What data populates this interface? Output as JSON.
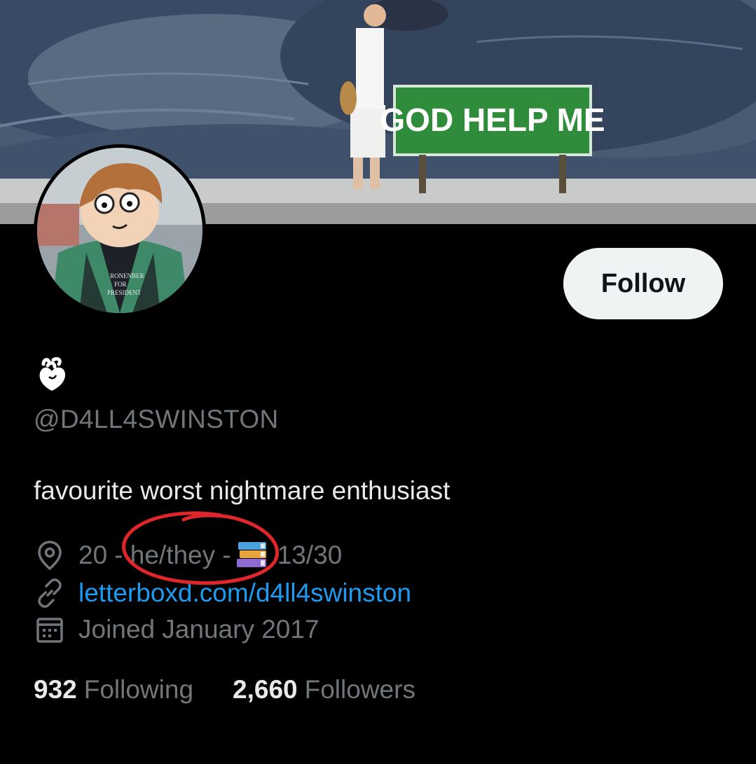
{
  "banner": {
    "sign_text": "GOD HELP ME"
  },
  "avatar": {
    "shirt_text_line1": "RONENBER",
    "shirt_text_line2": "FOR",
    "shirt_text_line3": "PRESIDENT"
  },
  "actions": {
    "follow_label": "Follow"
  },
  "profile": {
    "display_name_icon": "anatomical-heart-icon",
    "handle": "@D4LL4SWINSTON",
    "bio": "favourite worst nightmare enthusiast",
    "location": {
      "icon": "location-pin-icon",
      "prefix": "20",
      "pronouns": "- he/they -",
      "books_icon": "books-icon",
      "suffix": "13/30"
    },
    "website": {
      "icon": "link-icon",
      "text": "letterboxd.com/d4ll4swinston"
    },
    "joined": {
      "icon": "calendar-icon",
      "text": "Joined January 2017"
    }
  },
  "stats": {
    "following_count": "932",
    "following_label": "Following",
    "followers_count": "2,660",
    "followers_label": "Followers"
  },
  "colors": {
    "background": "#000000",
    "primary_text": "#e7e9ea",
    "secondary_text": "#71767b",
    "link": "#1d9bf0",
    "annotation": "#e0262b"
  }
}
